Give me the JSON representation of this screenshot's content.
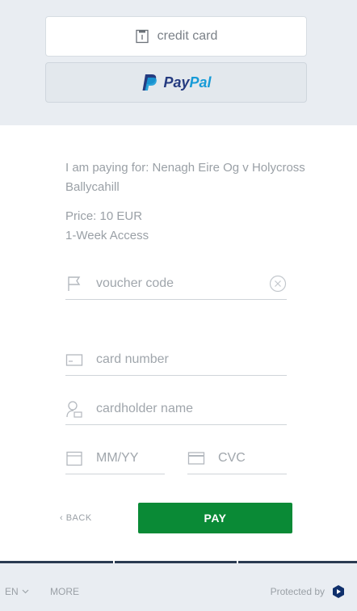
{
  "payment_methods": {
    "credit_card_label": "credit card",
    "paypal_label_part1": "Pay",
    "paypal_label_part2": "Pal"
  },
  "order": {
    "paying_for": "I am paying for: Nenagh Eire Og v Holycross Ballycahill",
    "price": "Price: 10 EUR",
    "access": "1-Week Access"
  },
  "form": {
    "voucher_placeholder": "voucher code",
    "card_number_placeholder": "card number",
    "cardholder_placeholder": "cardholder name",
    "expiry_placeholder": "MM/YY",
    "cvc_placeholder": "CVC"
  },
  "actions": {
    "back_label": "‹ BACK",
    "pay_label": "PAY"
  },
  "footer": {
    "language": "EN",
    "more_label": "MORE",
    "protected_label": "Protected by"
  },
  "colors": {
    "pay_button": "#0a8a36",
    "paypal_dark": "#253b80",
    "paypal_light": "#179bd7",
    "footer_divider": "#2a3b52"
  }
}
